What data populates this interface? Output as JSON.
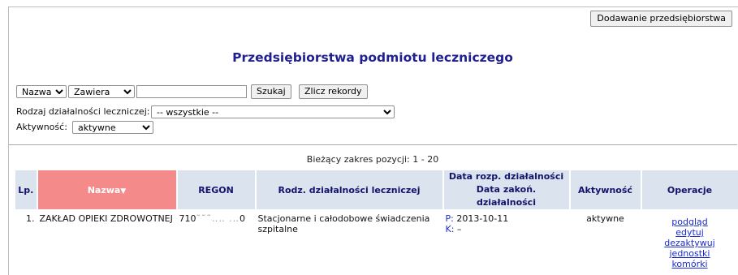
{
  "toolbar": {
    "add_enterprise_label": "Dodawanie przedsiębiorstwa"
  },
  "page": {
    "title": "Przedsiębiorstwa podmiotu leczniczego"
  },
  "filters": {
    "field_select": "Nazwa",
    "operator_select": "Zawiera",
    "search_value": "",
    "search_button": "Szukaj",
    "count_button": "Zlicz rekordy",
    "activity_type_label": "Rodzaj działalności leczniczej:",
    "activity_type_value": "-- wszystkie --",
    "active_label": "Aktywność:",
    "active_value": "aktywne"
  },
  "range_text": "Bieżący zakres pozycji: 1 - 20",
  "table": {
    "headers": {
      "lp": "Lp.",
      "name": "Nazwa",
      "regon": "REGON",
      "activity": "Rodz. działalności leczniczej",
      "date_start": "Data rozp. działalności",
      "date_end": "Data zakoń. działalności",
      "active": "Aktywność",
      "operations": "Operacje"
    },
    "sort_indicator": "▼",
    "rows": [
      {
        "lp": "1.",
        "name": "ZAKŁAD OPIEKI ZDROWOTNEJ",
        "regon": "710",
        "regon_suffix": "0",
        "activity": "Stacjonarne i całodobowe świadczenia szpitalne",
        "start_prefix": "P:",
        "start_date": "2013-10-11",
        "end_prefix": "K:",
        "end_date": "–",
        "active": "aktywne",
        "operations": [
          "podgląd",
          "edytuj",
          "dezaktywuj",
          "jednostki",
          "komórki"
        ]
      }
    ]
  },
  "colors": {
    "header_bg": "#dbe3ee",
    "sorted_header_bg": "#f58a8a",
    "title": "#1f1f8f",
    "link": "#1a2bd6"
  }
}
